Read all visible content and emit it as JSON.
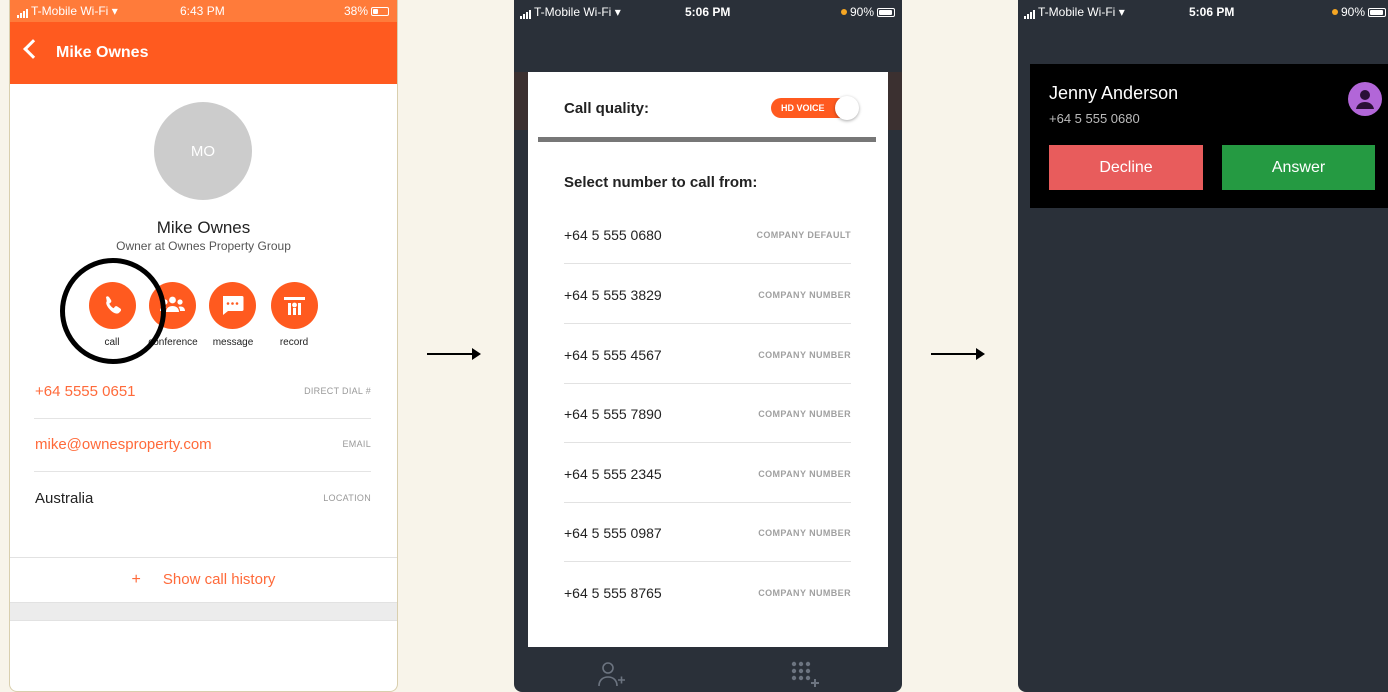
{
  "screen1": {
    "status": {
      "carrier": "T-Mobile Wi-Fi",
      "time": "6:43 PM",
      "battery": "38%"
    },
    "header_title": "Mike Ownes",
    "avatar_initials": "MO",
    "contact_name": "Mike Ownes",
    "contact_role": "Owner at Ownes Property Group",
    "actions": [
      {
        "label": "call",
        "icon": "phone-icon"
      },
      {
        "label": "conference",
        "icon": "group-icon"
      },
      {
        "label": "message",
        "icon": "chat-icon"
      },
      {
        "label": "record",
        "icon": "record-icon"
      }
    ],
    "fields": [
      {
        "value": "+64 5555 0651",
        "key": "DIRECT DIAL #"
      },
      {
        "value": "mike@ownesproperty.com",
        "key": "EMAIL"
      },
      {
        "value": "Australia",
        "key": "LOCATION"
      }
    ],
    "history_plus": "+",
    "history_label": "Show call history",
    "accent_color": "#ff5a1f"
  },
  "screen2": {
    "status": {
      "carrier": "T-Mobile Wi-Fi",
      "time": "5:06 PM",
      "battery": "90%"
    },
    "call_quality_label": "Call quality:",
    "hd_voice_label": "HD VOICE",
    "select_label": "Select number to call from:",
    "numbers": [
      {
        "number": "+64 5 555 0680",
        "kind": "COMPANY DEFAULT"
      },
      {
        "number": "+64 5 555 3829",
        "kind": "COMPANY NUMBER"
      },
      {
        "number": "+64 5 555 4567",
        "kind": "COMPANY NUMBER"
      },
      {
        "number": "+64 5 555 7890",
        "kind": "COMPANY NUMBER"
      },
      {
        "number": "+64 5 555 2345",
        "kind": "COMPANY NUMBER"
      },
      {
        "number": "+64 5 555 0987",
        "kind": "COMPANY NUMBER"
      },
      {
        "number": "+64 5 555 8765",
        "kind": "COMPANY NUMBER"
      }
    ]
  },
  "screen3": {
    "status": {
      "carrier": "T-Mobile Wi-Fi",
      "time": "5:06 PM",
      "battery": "90%"
    },
    "caller_name": "Jenny Anderson",
    "caller_number": "+64 5 555 0680",
    "decline_label": "Decline",
    "answer_label": "Answer",
    "decline_color": "#e85c5c",
    "answer_color": "#259a42"
  }
}
